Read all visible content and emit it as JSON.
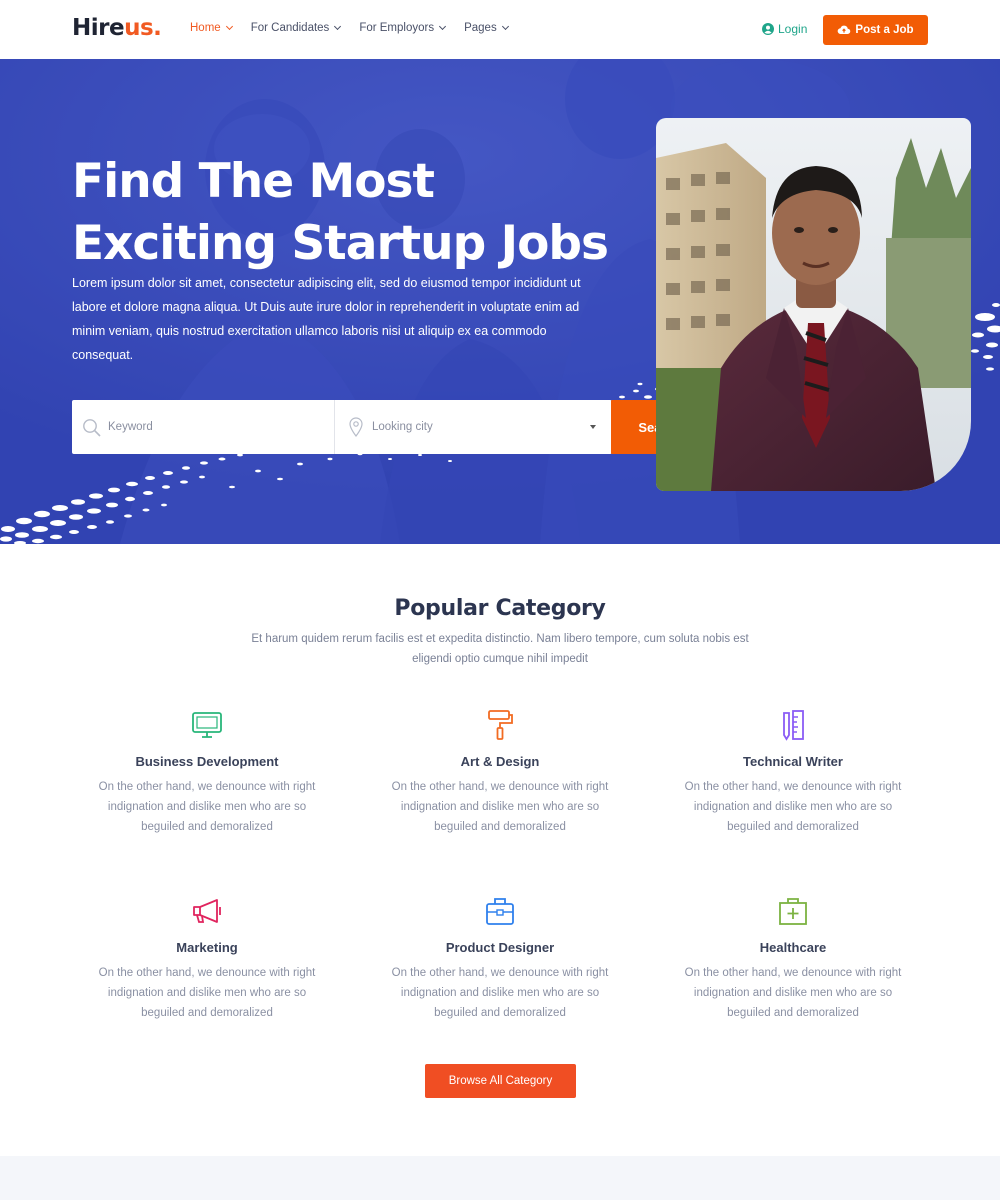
{
  "brand": {
    "name_main": "Hire",
    "name_accent": "us.",
    "accent_color": "#f15a22"
  },
  "nav": [
    {
      "label": "Home",
      "active": true
    },
    {
      "label": "For Candidates",
      "active": false
    },
    {
      "label": "For Employors",
      "active": false
    },
    {
      "label": "Pages",
      "active": false
    }
  ],
  "header": {
    "login_label": "Login",
    "post_job_label": "Post a Job"
  },
  "hero": {
    "title_line1": "Find The Most",
    "title_line2": "Exciting Startup Jobs",
    "description": "Lorem ipsum dolor sit amet, consectetur adipiscing elit, sed do eiusmod tempor incididunt ut labore et dolore magna aliqua. Ut Duis aute irure dolor in reprehenderit in voluptate enim ad minim veniam, quis nostrud exercitation ullamco laboris nisi ut aliquip ex ea commodo consequat.",
    "keyword_placeholder": "Keyword",
    "city_placeholder": "Looking city",
    "search_label": "Search",
    "bg_color": "#3446b6",
    "button_color": "#f25c05"
  },
  "categories_section": {
    "title": "Popular Category",
    "subtitle": "Et harum quidem rerum facilis est et expedita distinctio. Nam libero tempore, cum soluta nobis est eligendi optio cumque nihil impedit",
    "items": [
      {
        "name": "Business Development",
        "icon": "monitor-icon",
        "icon_color": "#28b67a",
        "description": "On the other hand, we denounce with right indignation and dislike men who are so beguiled and demoralized"
      },
      {
        "name": "Art & Design",
        "icon": "paint-roller-icon",
        "icon_color": "#f26b22",
        "description": "On the other hand, we denounce with right indignation and dislike men who are so beguiled and demoralized"
      },
      {
        "name": "Technical Writer",
        "icon": "pencil-ruler-icon",
        "icon_color": "#8b5cf6",
        "description": "On the other hand, we denounce with right indignation and dislike men who are so beguiled and demoralized"
      },
      {
        "name": "Marketing",
        "icon": "megaphone-icon",
        "icon_color": "#e0245e",
        "description": "On the other hand, we denounce with right indignation and dislike men who are so beguiled and demoralized"
      },
      {
        "name": "Product Designer",
        "icon": "briefcase-icon",
        "icon_color": "#2f80ed",
        "description": "On the other hand, we denounce with right indignation and dislike men who are so beguiled and demoralized"
      },
      {
        "name": "Healthcare",
        "icon": "medical-kit-icon",
        "icon_color": "#7cb342",
        "description": "On the other hand, we denounce with right indignation and dislike men who are so beguiled and demoralized"
      }
    ],
    "browse_label": "Browse All Category"
  }
}
